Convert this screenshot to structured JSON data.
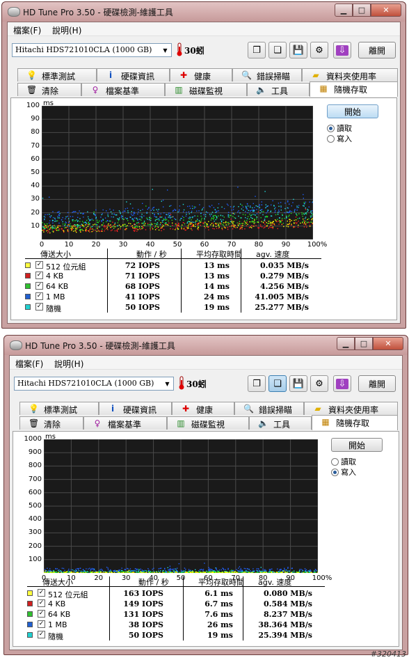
{
  "windows": [
    {
      "title": "HD Tune Pro 3.50 - 硬碟檢測-維護工具",
      "menu": [
        "檔案(F)",
        "說明(H)"
      ],
      "drive": "Hitachi HDS721010CLA (1000 GB)",
      "temperature": "30蚓",
      "exit_label": "離開",
      "tabs_row1": [
        "標準測試",
        "硬碟資訊",
        "健康",
        "錯誤掃瞄",
        "資料夾使用率"
      ],
      "tabs_row2": [
        "清除",
        "檔案基準",
        "磁碟監視",
        "工具",
        "隨機存取"
      ],
      "start_label": "開始",
      "radio_read": "讀取",
      "radio_write": "寫入",
      "mode": "read",
      "pressed_tool": "",
      "chart": {
        "unit": "ms",
        "ymax": 100,
        "yticks": [
          "100",
          "90",
          "80",
          "70",
          "60",
          "50",
          "40",
          "30",
          "20",
          "10"
        ],
        "xticks": [
          "0",
          "10",
          "20",
          "30",
          "40",
          "50",
          "60",
          "70",
          "80",
          "90",
          "100%"
        ],
        "bands": [
          {
            "color": "#ffff00",
            "base": 8,
            "rise": 5,
            "spread": 3
          },
          {
            "color": "#ff2020",
            "base": 8,
            "rise": 4,
            "spread": 3
          },
          {
            "color": "#20e020",
            "base": 10,
            "rise": 7,
            "spread": 4
          },
          {
            "color": "#2060ff",
            "base": 16,
            "rise": 10,
            "spread": 5
          },
          {
            "color": "#20e0e0",
            "base": 14,
            "rise": 8,
            "spread": 6
          }
        ]
      },
      "table_headers": [
        "傳送大小",
        "動作 / 秒",
        "平均存取時間",
        "agv. 速度"
      ],
      "rows": [
        {
          "color": "#ffff40",
          "size": "512 位元組",
          "ops": "72 IOPS",
          "time": "13 ms",
          "speed": "0.035 MB/s"
        },
        {
          "color": "#d02020",
          "size": "4 KB",
          "ops": "71 IOPS",
          "time": "13 ms",
          "speed": "0.279 MB/s"
        },
        {
          "color": "#30c030",
          "size": "64 KB",
          "ops": "68 IOPS",
          "time": "14 ms",
          "speed": "4.256 MB/s"
        },
        {
          "color": "#2060d0",
          "size": "1 MB",
          "ops": "41 IOPS",
          "time": "24 ms",
          "speed": "41.005 MB/s"
        },
        {
          "color": "#20d0d0",
          "size": "隨機",
          "ops": "50 IOPS",
          "time": "19 ms",
          "speed": "25.277 MB/s"
        }
      ]
    },
    {
      "title": "HD Tune Pro 3.50 - 硬碟檢測-維護工具",
      "menu": [
        "檔案(F)",
        "說明(H)"
      ],
      "drive": "Hitachi HDS721010CLA (1000 GB)",
      "temperature": "30蚓",
      "exit_label": "離開",
      "tabs_row1": [
        "標準測試",
        "硬碟資訊",
        "健康",
        "錯誤掃瞄",
        "資料夾使用率"
      ],
      "tabs_row2": [
        "清除",
        "檔案基準",
        "磁碟監視",
        "工具",
        "隨機存取"
      ],
      "start_label": "開始",
      "radio_read": "讀取",
      "radio_write": "寫入",
      "mode": "write",
      "pressed_tool": "copy",
      "chart": {
        "unit": "ms",
        "ymax": 1000,
        "yticks": [
          "1000",
          "900",
          "800",
          "700",
          "600",
          "500",
          "400",
          "300",
          "200",
          "100"
        ],
        "xticks": [
          "0",
          "10",
          "20",
          "30",
          "40",
          "50",
          "60",
          "70",
          "80",
          "90",
          "100%"
        ],
        "bands": [
          {
            "color": "#20e0e0",
            "base": 12,
            "rise": 0,
            "spread": 10
          },
          {
            "color": "#2060ff",
            "base": 25,
            "rise": 0,
            "spread": 15
          },
          {
            "color": "#20e020",
            "base": 8,
            "rise": 0,
            "spread": 6
          },
          {
            "color": "#ffff00",
            "base": 6,
            "rise": 0,
            "spread": 5
          }
        ]
      },
      "table_headers": [
        "傳送大小",
        "動作 / 秒",
        "平均存取時間",
        "agv. 速度"
      ],
      "rows": [
        {
          "color": "#ffff40",
          "size": "512 位元組",
          "ops": "163 IOPS",
          "time": "6.1 ms",
          "speed": "0.080 MB/s"
        },
        {
          "color": "#d02020",
          "size": "4 KB",
          "ops": "149 IOPS",
          "time": "6.7 ms",
          "speed": "0.584 MB/s"
        },
        {
          "color": "#30c030",
          "size": "64 KB",
          "ops": "131 IOPS",
          "time": "7.6 ms",
          "speed": "8.237 MB/s"
        },
        {
          "color": "#2060d0",
          "size": "1 MB",
          "ops": "38 IOPS",
          "time": "26 ms",
          "speed": "38.364 MB/s"
        },
        {
          "color": "#20d0d0",
          "size": "隨機",
          "ops": "50 IOPS",
          "time": "19 ms",
          "speed": "25.394 MB/s"
        }
      ]
    }
  ],
  "watermark": "#320413"
}
